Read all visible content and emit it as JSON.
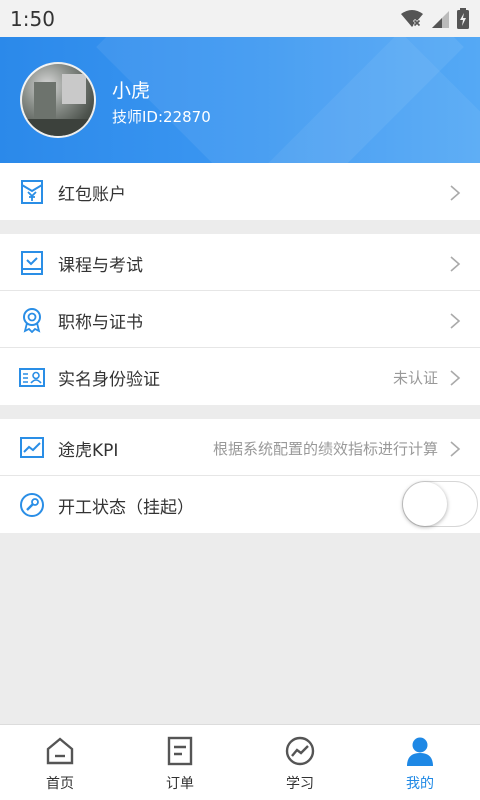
{
  "status_bar": {
    "time": "1:50"
  },
  "profile": {
    "name": "小虎",
    "tech_id": "技师ID:22870"
  },
  "menu": {
    "red_packet": {
      "label": "红包账户",
      "icon": "red-packet-icon"
    },
    "courses": {
      "label": "课程与考试",
      "icon": "course-icon"
    },
    "titles": {
      "label": "职称与证书",
      "icon": "certificate-icon"
    },
    "realname": {
      "label": "实名身份验证",
      "value": "未认证",
      "icon": "id-card-icon"
    },
    "kpi": {
      "label": "途虎KPI",
      "value": "根据系统配置的绩效指标进行计算",
      "icon": "kpi-chart-icon"
    },
    "work_status": {
      "label": "开工状态（挂起）",
      "toggle_on": false,
      "icon": "wrench-icon"
    }
  },
  "tabs": [
    {
      "label": "首页",
      "icon": "home-icon",
      "active": false
    },
    {
      "label": "订单",
      "icon": "order-icon",
      "active": false
    },
    {
      "label": "学习",
      "icon": "study-icon",
      "active": false
    },
    {
      "label": "我的",
      "icon": "profile-icon",
      "active": true
    }
  ],
  "colors": {
    "accent": "#1e88e5",
    "header_start": "#2b89ea",
    "header_end": "#55a9f5",
    "icon_blue": "#2a8ee6"
  }
}
